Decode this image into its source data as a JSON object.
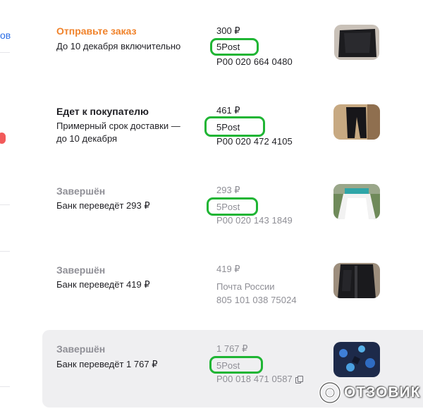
{
  "sidebar": {
    "link_fragment": "ов"
  },
  "orders": [
    {
      "status": "Отправьте заказ",
      "subtitle": "До 10 декабря включительно",
      "price": "300 ₽",
      "carrier": "5Post",
      "track": "P00 020 664 0480",
      "status_color": "#f0822a"
    },
    {
      "status": "Едет к покупателю",
      "subtitle_line1": "Примерный срок доставки —",
      "subtitle_line2": "до 10 декабря",
      "price": "461 ₽",
      "carrier": "5Post",
      "track": "P00 020 472 4105"
    },
    {
      "status": "Завершён",
      "subtitle": "Банк переведёт 293 ₽",
      "price": "293 ₽",
      "carrier": "5Post",
      "track": "P00 020 143 1849"
    },
    {
      "status": "Завершён",
      "subtitle": "Банк переведёт 419 ₽",
      "price": "419 ₽",
      "carrier": "Почта России",
      "track": "805 101 038 75024"
    },
    {
      "status": "Завершён",
      "subtitle": "Банк переведёт 1 767 ₽",
      "price": "1 767 ₽",
      "carrier": "5Post",
      "track": "P00 018 471 0587"
    }
  ],
  "watermark": {
    "text": "ОТЗОВИК",
    "icon": "otzovik-logo-icon"
  },
  "colors": {
    "accent_link": "#2b6ee6",
    "annotation_green": "#1fb534",
    "highlight_row": "#efeff1",
    "muted_text": "#8f8f96"
  }
}
